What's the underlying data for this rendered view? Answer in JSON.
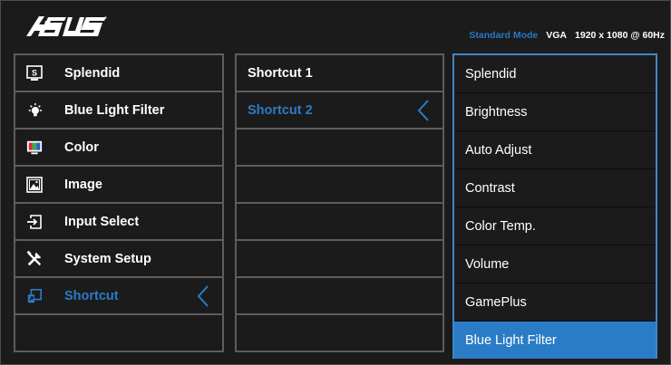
{
  "header": {
    "logo_text": "ASUS",
    "mode": "Standard Mode",
    "input": "VGA",
    "resolution": "1920 x 1080 @ 60Hz"
  },
  "menu": [
    {
      "label": "Splendid",
      "icon": "splendid-icon"
    },
    {
      "label": "Blue Light Filter",
      "icon": "bulb-icon"
    },
    {
      "label": "Color",
      "icon": "color-icon"
    },
    {
      "label": "Image",
      "icon": "image-icon"
    },
    {
      "label": "Input Select",
      "icon": "input-select-icon"
    },
    {
      "label": "System Setup",
      "icon": "tools-icon"
    },
    {
      "label": "Shortcut",
      "icon": "shortcut-icon",
      "selected": true
    }
  ],
  "submenu": [
    {
      "label": "Shortcut 1"
    },
    {
      "label": "Shortcut 2",
      "selected": true
    }
  ],
  "options": [
    "Splendid",
    "Brightness",
    "Auto Adjust",
    "Contrast",
    "Color Temp.",
    "Volume",
    "GamePlus",
    "Blue Light Filter"
  ],
  "selected_option_index": 7,
  "colors": {
    "accent": "#2b7cc6",
    "background": "#1b1b1b",
    "border": "#5d5d5d"
  }
}
